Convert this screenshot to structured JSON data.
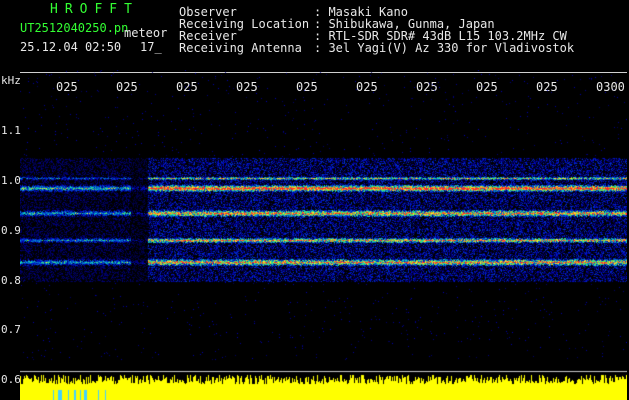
{
  "app": {
    "title": "HROFFT"
  },
  "file": {
    "name": "UT2512040250.pn",
    "tag": "meteor"
  },
  "status": {
    "datetime": "25.12.04 02:50",
    "count": "17_"
  },
  "header": {
    "observer_label": "Observer",
    "observer_value": ": Masaki Kano",
    "location_label": "Receiving Location",
    "location_value": ": Shibukawa, Gunma, Japan",
    "receiver_label": "Receiver",
    "receiver_value": ": RTL-SDR SDR# 43dB L15 103.2MHz CW",
    "antenna_label": "Receiving Antenna",
    "antenna_value": ": 3el Yagi(V) Az 330 for Vladivostok"
  },
  "axes": {
    "unit": "kHz",
    "x_ticks": [
      "025",
      "025",
      "025",
      "025",
      "025",
      "025",
      "025",
      "025",
      "025",
      "0300"
    ],
    "y_ticks": [
      "1.1",
      "1.0",
      "0.9",
      "0.8",
      "0.7",
      "0.6"
    ]
  },
  "colors": {
    "background": "#000000",
    "title": "#33ff33",
    "text": "#e8e8e8",
    "noise": "#0a1aa8",
    "band_hot": "#ff3030",
    "band_mid": "#40ff60",
    "baseline": "#ffff00"
  }
}
